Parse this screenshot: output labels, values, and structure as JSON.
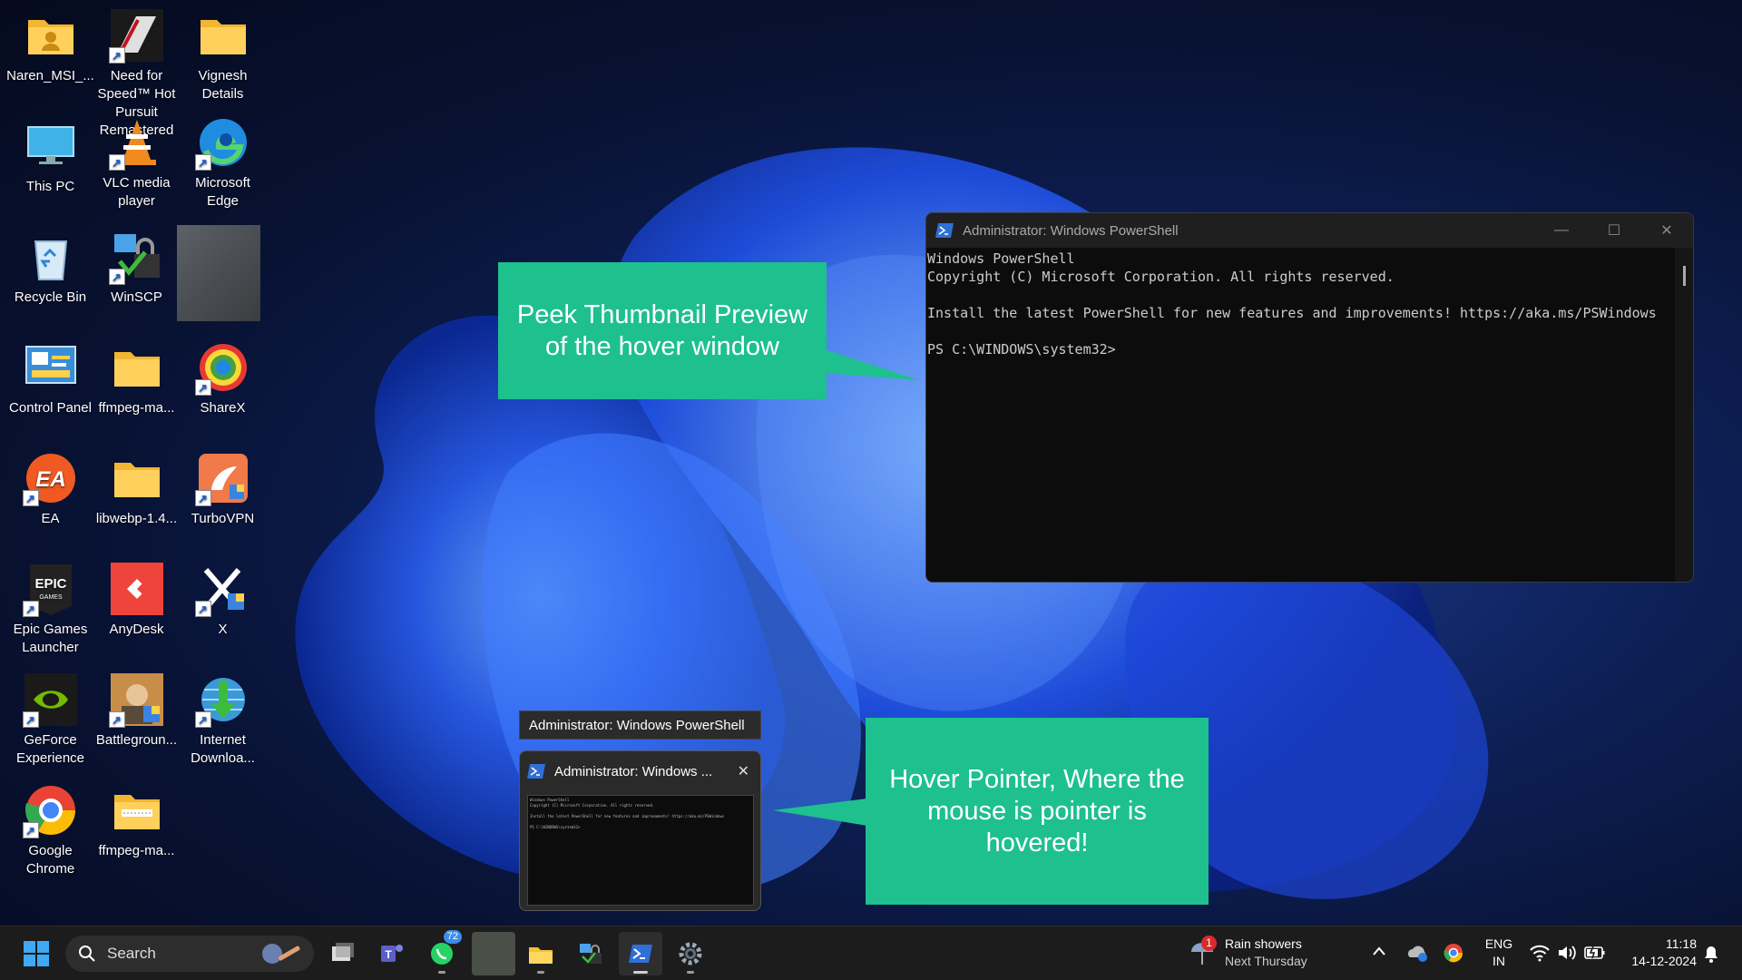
{
  "desktop_icons": [
    {
      "label": "Naren_MSI_...",
      "icon": "user-folder-icon"
    },
    {
      "label": "Need for Speed™ Hot Pursuit Remastered",
      "icon": "nfs-game-icon"
    },
    {
      "label": "Vignesh Details",
      "icon": "folder-icon"
    },
    {
      "label": "This PC",
      "icon": "monitor-icon"
    },
    {
      "label": "VLC media player",
      "icon": "vlc-icon"
    },
    {
      "label": "Microsoft Edge",
      "icon": "edge-icon"
    },
    {
      "label": "Recycle Bin",
      "icon": "recycle-bin-icon"
    },
    {
      "label": "WinSCP",
      "icon": "winscp-icon"
    },
    {
      "label": "Control Panel",
      "icon": "control-panel-icon"
    },
    {
      "label": "ffmpeg-ma...",
      "icon": "folder-icon"
    },
    {
      "label": "ShareX",
      "icon": "sharex-icon"
    },
    {
      "label": "EA",
      "icon": "ea-icon"
    },
    {
      "label": "libwebp-1.4...",
      "icon": "folder-icon"
    },
    {
      "label": "TurboVPN",
      "icon": "turbovpn-icon"
    },
    {
      "label": "Epic Games Launcher",
      "icon": "epic-games-icon"
    },
    {
      "label": "AnyDesk",
      "icon": "anydesk-icon"
    },
    {
      "label": "X",
      "icon": "x-app-icon"
    },
    {
      "label": "GeForce Experience",
      "icon": "nvidia-icon"
    },
    {
      "label": "Battlegroun...",
      "icon": "battlegrounds-icon"
    },
    {
      "label": "Internet Downloa...",
      "icon": "idm-icon"
    },
    {
      "label": "Google Chrome",
      "icon": "chrome-icon"
    },
    {
      "label": "ffmpeg-ma...",
      "icon": "zip-folder-icon"
    }
  ],
  "callouts": {
    "peek": "Peek Thumbnail Preview of the hover window",
    "hover": "Hover Pointer, Where the mouse is pointer is hovered!"
  },
  "powershell": {
    "title": "Administrator: Windows PowerShell",
    "lines": [
      "Windows PowerShell",
      "Copyright (C) Microsoft Corporation. All rights reserved.",
      "",
      "Install the latest PowerShell for new features and improvements! https://aka.ms/PSWindows",
      "",
      "PS C:\\WINDOWS\\system32>"
    ]
  },
  "hover_preview": {
    "tooltip": "Administrator: Windows PowerShell",
    "thumb_title": "Administrator: Windows ...",
    "close": "✕"
  },
  "taskbar": {
    "search_placeholder": "Search",
    "whatsapp_badge": "72",
    "weather": {
      "badge": "1",
      "line1": "Rain showers",
      "line2": "Next Thursday"
    },
    "language": {
      "line1": "ENG",
      "line2": "IN"
    },
    "clock": {
      "time": "11:18",
      "date": "14-12-2024"
    }
  },
  "colors": {
    "callout": "#1ec08e",
    "taskbar": "#1c1c1c",
    "accent": "#0078d4"
  }
}
